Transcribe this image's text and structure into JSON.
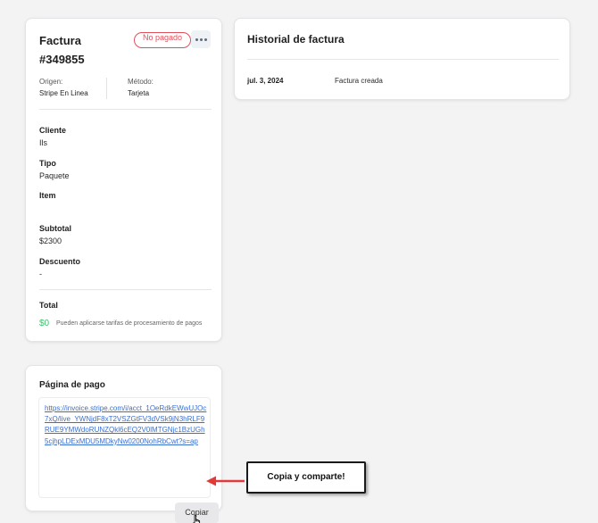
{
  "invoice": {
    "title_line1": "Factura",
    "title_line2": "#349855",
    "status_badge": "No pagado",
    "origin_label": "Origen:",
    "origin_value": "Stripe En Linea",
    "method_label": "Método:",
    "method_value": "Tarjeta",
    "client_label": "Cliente",
    "client_value": "Ils",
    "type_label": "Tipo",
    "type_value": "Paquete",
    "item_label": "Item",
    "subtotal_label": "Subtotal",
    "subtotal_value": "$2300",
    "discount_label": "Descuento",
    "discount_value": "-",
    "total_label": "Total",
    "total_value": "$0",
    "total_note": "Pueden aplicarse tarifas de procesamiento de pagos"
  },
  "history": {
    "title": "Historial de factura",
    "entries": [
      {
        "date": "jul. 3, 2024",
        "event": "Factura creada"
      }
    ]
  },
  "payment_page": {
    "title": "Página de pago",
    "link": "https://invoice.stripe.com/i/acct_1OeRdkEWwUJOc7xQ/live_YWNjdF8xT2VSZGtFV3dVSk9jN3hRLF9RUE9YMWdoRUNZQkl6cEQ2V0lMTGNjc1BzUGh5cjhpLDExMDU5MDkyNw0200NohRbCwt?s=ap",
    "copy_label": "Copiar"
  },
  "callout": {
    "text": "Copia y comparte!"
  },
  "colors": {
    "unpaid": "#e0505a",
    "total_green": "#3fbf6b",
    "link_blue": "#3a6fd0",
    "arrow_red": "#e03a3a"
  }
}
